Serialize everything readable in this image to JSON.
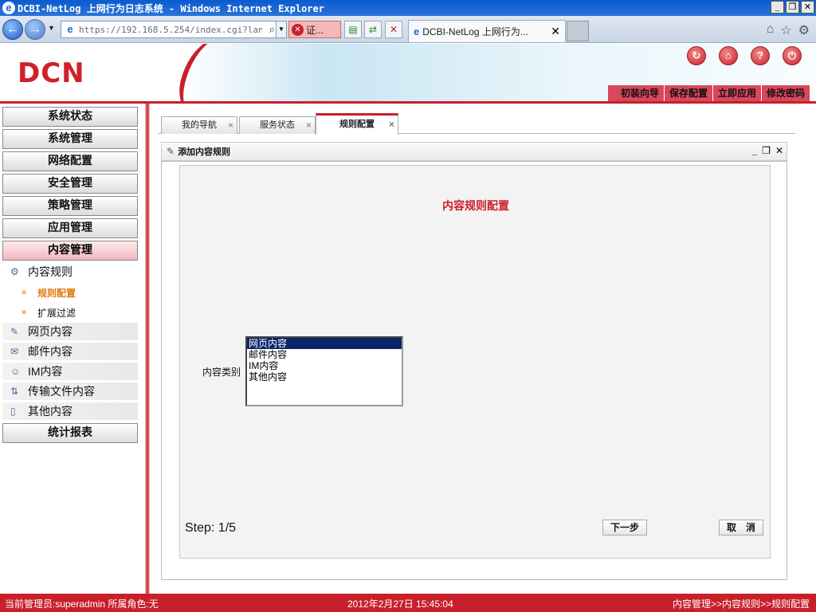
{
  "browser": {
    "window_title": "DCBI-NetLog 上网行为日志系统 - Windows Internet Explorer",
    "url": "https://192.168.5.254/index.cgi?lang=z",
    "cert_label": "证...",
    "tab_title": "DCBI-NetLog 上网行为...",
    "min": "_",
    "max": "❐",
    "close": "✕"
  },
  "header": {
    "logo": "DCN",
    "menu": [
      "初装向导",
      "保存配置",
      "立即应用",
      "修改密码"
    ]
  },
  "sidebar": {
    "buttons_top": [
      "系统状态",
      "系统管理",
      "网络配置",
      "安全管理",
      "策略管理",
      "应用管理",
      "内容管理"
    ],
    "content_rule": "内容规则",
    "leaves": [
      "规则配置",
      "扩展过滤"
    ],
    "subitems": [
      "网页内容",
      "邮件内容",
      "IM内容",
      "传输文件内容",
      "其他内容"
    ],
    "buttons_bottom": [
      "统计报表"
    ]
  },
  "tabs": [
    {
      "label": "我的导航",
      "active": false
    },
    {
      "label": "服务状态",
      "active": false
    },
    {
      "label": "规则配置",
      "active": true
    }
  ],
  "panel": {
    "header_title": "添加内容规则",
    "title": "内容规则配置",
    "field_label": "内容类别",
    "options": [
      "网页内容",
      "邮件内容",
      "IM内容",
      "其他内容"
    ],
    "selected_index": 0,
    "step": "Step: 1/5",
    "next_label": "下一步",
    "cancel_label": "取　消"
  },
  "status": {
    "admin": "当前管理员:superadmin  所属角色:无",
    "datetime": "2012年2月27日 15:45:04",
    "path": "内容管理>>内容规则>>规则配置"
  },
  "colors": {
    "brand_red": "#c8202a",
    "selection_blue": "#0a246a"
  }
}
